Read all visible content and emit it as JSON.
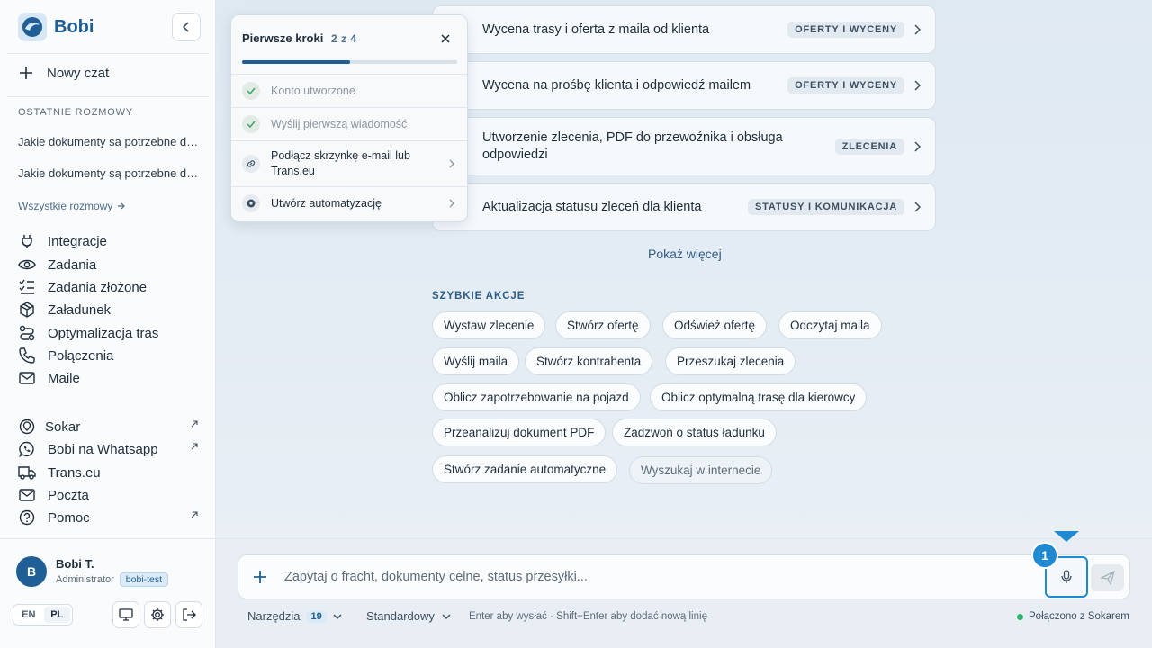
{
  "brand": {
    "name": "Bobi"
  },
  "sidebar": {
    "new_chat": "Nowy czat",
    "recent_title": "OSTATNIE ROZMOWY",
    "recent": [
      "Jakie dokumenty sa potrzebne do...",
      "Jakie dokumenty są potrzebne do..."
    ],
    "all_conversations": "Wszystkie rozmowy",
    "nav": [
      "Integracje",
      "Zadania",
      "Zadania złożone",
      "Załadunek",
      "Optymalizacja tras",
      "Połączenia",
      "Maile"
    ],
    "links": [
      "Sokar",
      "Bobi na Whatsapp",
      "Trans.eu",
      "Poczta",
      "Pomoc"
    ],
    "profile": {
      "initial": "B",
      "name": "Bobi T.",
      "role": "Administrator",
      "tag": "bobi-test"
    },
    "lang": {
      "en": "EN",
      "pl": "PL",
      "active": "PL"
    }
  },
  "popup": {
    "title": "Pierwsze kroki",
    "count": "2 z 4",
    "progress": 0.5,
    "steps": [
      {
        "label": "Konto utworzone",
        "done": true
      },
      {
        "label": "Wyślij pierwszą wiadomość",
        "done": true
      },
      {
        "label": "Podłącz skrzynkę e-mail lub Trans.eu",
        "done": false
      },
      {
        "label": "Utwórz automatyzację",
        "done": false
      }
    ]
  },
  "cards": [
    {
      "title": "Wycena trasy i oferta z maila od klienta",
      "badge": "OFERTY I WYCENY"
    },
    {
      "title": "Wycena na prośbę klienta i odpowiedź mailem",
      "badge": "OFERTY I WYCENY"
    },
    {
      "title": "Utworzenie zlecenia, PDF do przewoźnika i obsługa odpowiedzi",
      "badge": "ZLECENIA"
    },
    {
      "title": "Aktualizacja statusu zleceń dla klienta",
      "badge": "STATUSY I KOMUNIKACJA"
    }
  ],
  "show_more": "Pokaż więcej",
  "quick_actions": {
    "title": "SZYBKIE AKCJE",
    "chips": [
      "Wystaw zlecenie",
      "Stwórz ofertę",
      "Odśwież ofertę",
      "Odczytaj maila",
      "Wyślij maila",
      "Stwórz kontrahenta",
      "Przeszukaj zlecenia",
      "Oblicz zapotrzebowanie na pojazd",
      "Oblicz optymalną trasę dla kierowcy",
      "Przeanalizuj dokument PDF",
      "Zadzwoń o status ładunku",
      "Stwórz zadanie automatyczne",
      "Wyszukaj w internecie"
    ]
  },
  "composer": {
    "placeholder": "Zapytaj o fracht, dokumenty celne, status przesyłki...",
    "tools_label": "Narzędzia",
    "tools_count": "19",
    "mode": "Standardowy",
    "hint": "Enter aby wysłać · Shift+Enter aby dodać nową linię",
    "status": "Połączono z Sokarem",
    "marker": "1"
  },
  "colors": {
    "accent": "#1f5f95",
    "highlight": "#1f8ad1",
    "status_ok": "#2db56b"
  }
}
